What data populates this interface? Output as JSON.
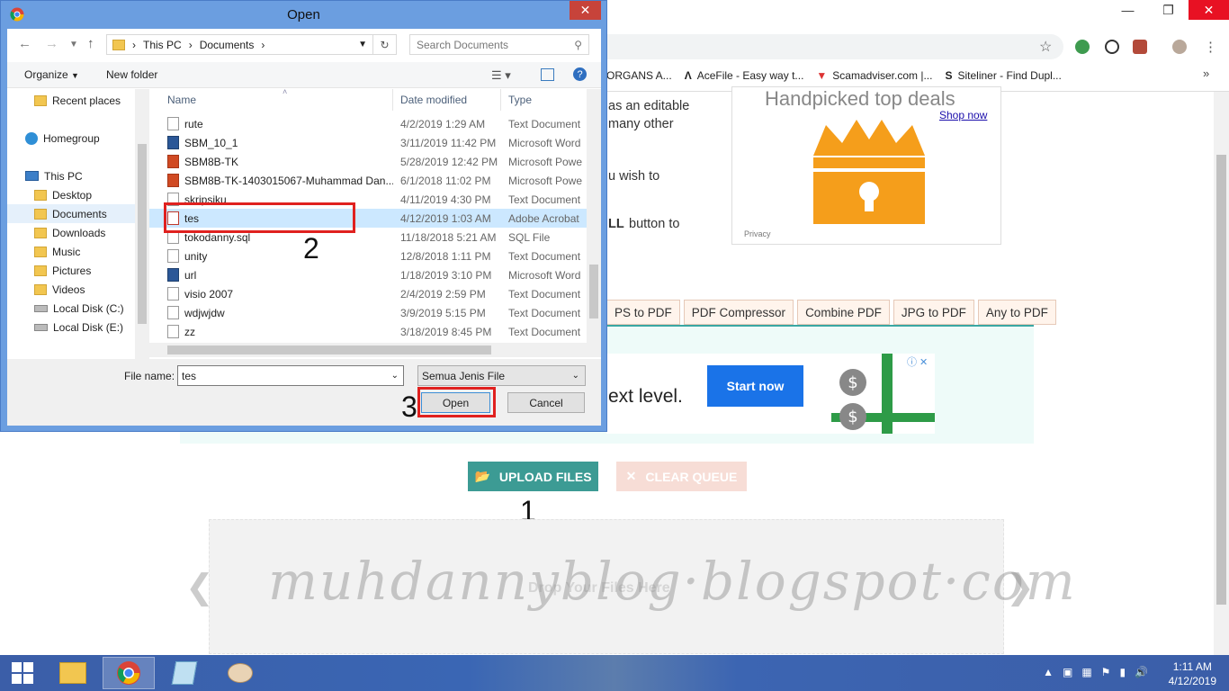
{
  "browser": {
    "bookmarks": [
      "ORGANS A...",
      "AceFile - Easy way t...",
      "Scamadviser.com |...",
      "Siteliner - Find Dupl..."
    ]
  },
  "page": {
    "partial_text": [
      "as an editable",
      "many other",
      "u wish to",
      "LL",
      "button to"
    ],
    "ad1": {
      "title": "Handpicked top deals",
      "shop": "Shop now",
      "privacy": "Privacy"
    },
    "tabs": [
      "PS to PDF",
      "PDF Compressor",
      "Combine PDF",
      "JPG to PDF",
      "Any to PDF"
    ],
    "ad2": {
      "text": "ext level.",
      "button": "Start now"
    },
    "upload_label": "UPLOAD FILES",
    "clear_label": "CLEAR QUEUE",
    "drop_text": "Drop Your Files Here",
    "watermark": "muhdannyblog·blogspot·com"
  },
  "annotations": {
    "one": "1",
    "two": "2",
    "three": "3"
  },
  "taskbar": {
    "time": "1:11 AM",
    "date": "4/12/2019"
  },
  "dialog": {
    "title": "Open",
    "path": [
      "This PC",
      "Documents"
    ],
    "search_placeholder": "Search Documents",
    "organize": "Organize",
    "new_folder": "New folder",
    "tree": [
      "Recent places",
      "Homegroup",
      "This PC",
      "Desktop",
      "Documents",
      "Downloads",
      "Music",
      "Pictures",
      "Videos",
      "Local Disk (C:)",
      "Local Disk (E:)"
    ],
    "columns": [
      "Name",
      "Date modified",
      "Type"
    ],
    "files": [
      {
        "name": "rute",
        "date": "4/2/2019 1:29 AM",
        "type": "Text Document",
        "icon": "txt"
      },
      {
        "name": "SBM_10_1",
        "date": "3/11/2019 11:42 PM",
        "type": "Microsoft Word",
        "icon": "word"
      },
      {
        "name": "SBM8B-TK",
        "date": "5/28/2019 12:42 PM",
        "type": "Microsoft Powe",
        "icon": "ppt"
      },
      {
        "name": "SBM8B-TK-1403015067-Muhammad Dan...",
        "date": "6/1/2018 11:02 PM",
        "type": "Microsoft Powe",
        "icon": "ppt"
      },
      {
        "name": "skripsiku",
        "date": "4/11/2019 4:30 PM",
        "type": "Text Document",
        "icon": "txt"
      },
      {
        "name": "tes",
        "date": "4/12/2019 1:03 AM",
        "type": "Adobe Acrobat",
        "icon": "pdf"
      },
      {
        "name": "tokodanny.sql",
        "date": "11/18/2018 5:21 AM",
        "type": "SQL File",
        "icon": "txt"
      },
      {
        "name": "unity",
        "date": "12/8/2018 1:11 PM",
        "type": "Text Document",
        "icon": "txt"
      },
      {
        "name": "url",
        "date": "1/18/2019 3:10 PM",
        "type": "Microsoft Word",
        "icon": "word"
      },
      {
        "name": "visio 2007",
        "date": "2/4/2019 2:59 PM",
        "type": "Text Document",
        "icon": "txt"
      },
      {
        "name": "wdjwjdw",
        "date": "3/9/2019 5:15 PM",
        "type": "Text Document",
        "icon": "txt"
      },
      {
        "name": "zz",
        "date": "3/18/2019 8:45 PM",
        "type": "Text Document",
        "icon": "txt"
      }
    ],
    "selected_file": "tes",
    "file_name_label": "File name:",
    "file_name_value": "tes",
    "file_type": "Semua Jenis File",
    "open_label": "Open",
    "cancel_label": "Cancel"
  }
}
